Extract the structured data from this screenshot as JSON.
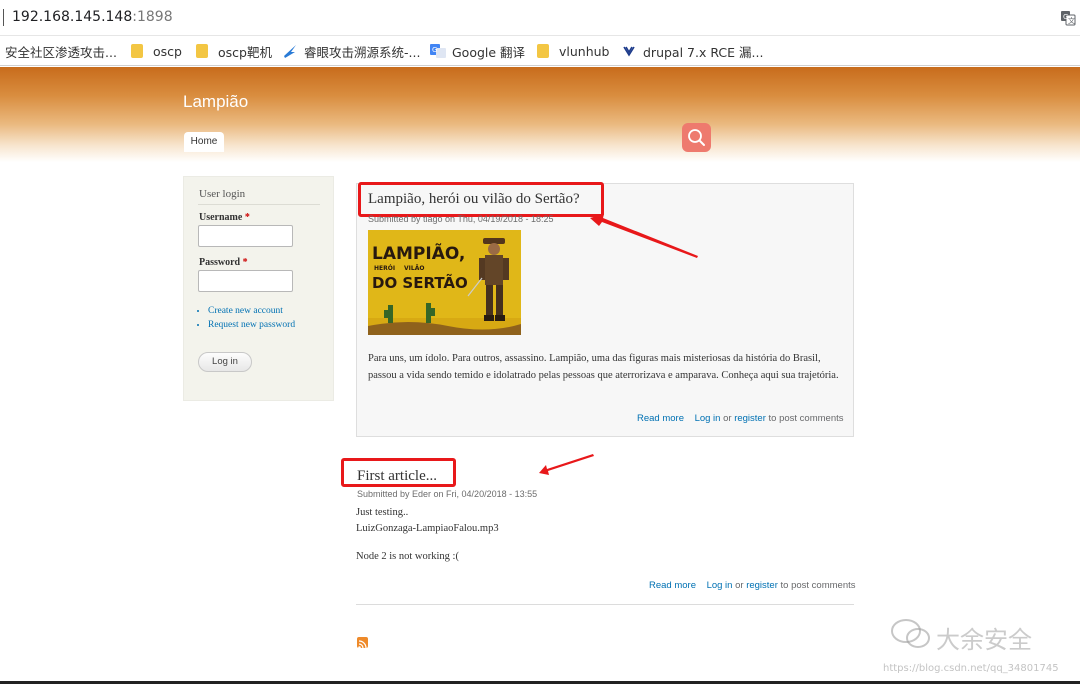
{
  "browser": {
    "url_host": "192.168.145.148",
    "url_port": ":1898",
    "bookmarks": [
      {
        "label": "安全社区渗透攻击...",
        "icon": "none"
      },
      {
        "label": "oscp",
        "icon": "folder-icon"
      },
      {
        "label": "oscp靶机",
        "icon": "folder-icon"
      },
      {
        "label": "睿眼攻击溯源系统-...",
        "icon": "swallow-icon"
      },
      {
        "label": "Google 翻译",
        "icon": "google-translate-icon"
      },
      {
        "label": "vlunhub",
        "icon": "folder-icon"
      },
      {
        "label": "drupal 7.x RCE 漏...",
        "icon": "drupal-icon"
      }
    ]
  },
  "site": {
    "name": "Lampião",
    "nav_home": "Home",
    "header_color": "#c86c1c",
    "search_button_color": "#ee7a6e"
  },
  "login": {
    "title": "User login",
    "username_label": "Username",
    "password_label": "Password",
    "required_mark": "*",
    "links": [
      "Create new account",
      "Request new password"
    ],
    "submit": "Log in"
  },
  "articles": [
    {
      "title": "Lampião, herói ou vilão do Sertão?",
      "meta": "Submitted by tiago on Thu, 04/19/2018 - 18:25",
      "image_text": [
        "LAMPIÃO,",
        "HERÓI",
        "VILÃO",
        "DO SERTÃO"
      ],
      "body": "Para uns, um ídolo. Para outros, assassino. Lampião, uma das figuras mais misteriosas da história do Brasil, passou a vida sendo temido e idolatrado pelas pessoas que aterrorizava e amparava. Conheça aqui sua trajetória.",
      "read_more": "Read more",
      "login": "Log in",
      "or": "or",
      "register": "register",
      "post_comments": "to post comments"
    },
    {
      "title": "First article...",
      "meta": "Submitted by Eder on Fri, 04/20/2018 - 13:55",
      "body_lines": [
        "Just testing..",
        "LuizGonzaga-LampiaoFalou.mp3",
        "Node 2 is not working :("
      ],
      "read_more": "Read more",
      "login": "Log in",
      "or": "or",
      "register": "register",
      "post_comments": "to post comments"
    }
  ],
  "annotation_color": "#e8181a",
  "watermark": {
    "brand": "大余安全",
    "url": "https://blog.csdn.net/qq_34801745"
  }
}
